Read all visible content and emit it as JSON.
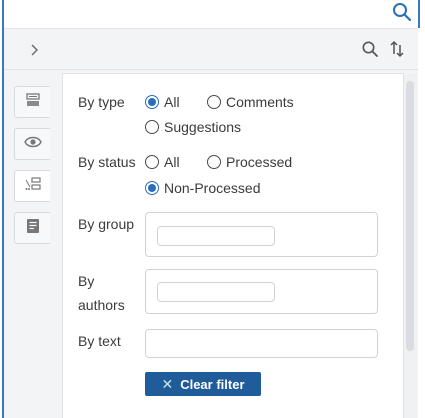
{
  "filters": {
    "by_type": {
      "label": "By type",
      "options": [
        "All",
        "Comments",
        "Suggestions"
      ],
      "selected": "All"
    },
    "by_status": {
      "label": "By status",
      "options": [
        "All",
        "Processed",
        "Non-Processed"
      ],
      "selected": "Non-Processed"
    },
    "by_group": {
      "label": "By group",
      "value": ""
    },
    "by_authors": {
      "label_line1": "By",
      "label_line2": "authors",
      "value": ""
    },
    "by_text": {
      "label": "By text",
      "value": ""
    },
    "clear_label": "Clear filter"
  },
  "icons": {
    "top_search": "search-icon",
    "header_search": "search-icon",
    "header_sort": "sort-icon",
    "expand": "chevron-right-icon",
    "side_tabs": [
      "comments-list-icon",
      "eye-icon",
      "filter-icon",
      "document-icon"
    ]
  },
  "colors": {
    "accent": "#2a6ebb",
    "button_bg": "#1f5c99",
    "frame_blue": "#3a78c4"
  }
}
